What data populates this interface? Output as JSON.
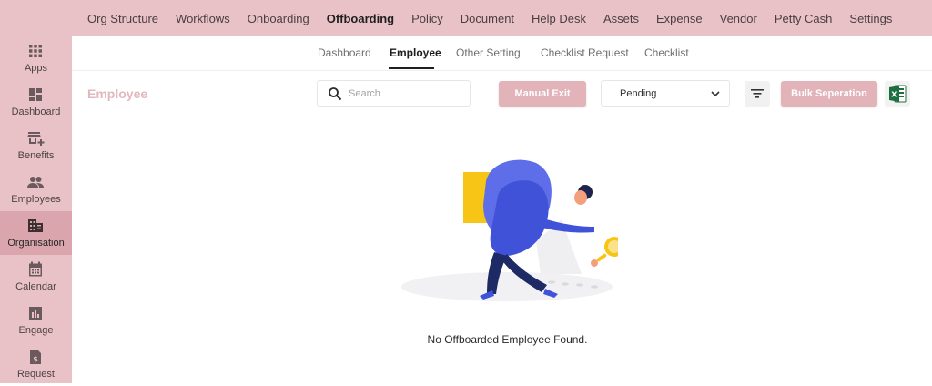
{
  "topnav": {
    "items": [
      {
        "label": "Org Structure"
      },
      {
        "label": "Workflows"
      },
      {
        "label": "Onboarding"
      },
      {
        "label": "Offboarding",
        "active": true
      },
      {
        "label": "Policy"
      },
      {
        "label": "Document"
      },
      {
        "label": "Help Desk"
      },
      {
        "label": "Assets"
      },
      {
        "label": "Expense"
      },
      {
        "label": "Vendor"
      },
      {
        "label": "Petty Cash"
      },
      {
        "label": "Settings"
      }
    ]
  },
  "sidebar": {
    "items": [
      {
        "label": "Apps",
        "icon": "apps-grid-icon"
      },
      {
        "label": "Dashboard",
        "icon": "dashboard-icon"
      },
      {
        "label": "Benefits",
        "icon": "benefits-store-icon"
      },
      {
        "label": "Employees",
        "icon": "people-icon"
      },
      {
        "label": "Organisation",
        "icon": "building-icon",
        "active": true
      },
      {
        "label": "Calendar",
        "icon": "calendar-icon"
      },
      {
        "label": "Engage",
        "icon": "bar-chart-icon"
      },
      {
        "label": "Request",
        "icon": "request-document-icon"
      }
    ]
  },
  "subnav": {
    "items": [
      {
        "label": "Dashboard"
      },
      {
        "label": "Employee",
        "active": true
      },
      {
        "label": "Other Setting"
      },
      {
        "label": "Checklist Request"
      },
      {
        "label": "Checklist"
      }
    ]
  },
  "toolbar": {
    "page_title": "Employee",
    "search_placeholder": "Search",
    "manual_exit_label": "Manual Exit",
    "status_value": "Pending",
    "bulk_label": "Bulk Seperation",
    "export_icon": "excel-icon"
  },
  "empty_state": {
    "message": "No Offboarded Employee Found."
  },
  "colors": {
    "nav_background": "#e9c2c7",
    "sidebar_active": "#dba5ad",
    "button_pink": "#e2b3b9",
    "title_pink": "#e2b8be"
  }
}
